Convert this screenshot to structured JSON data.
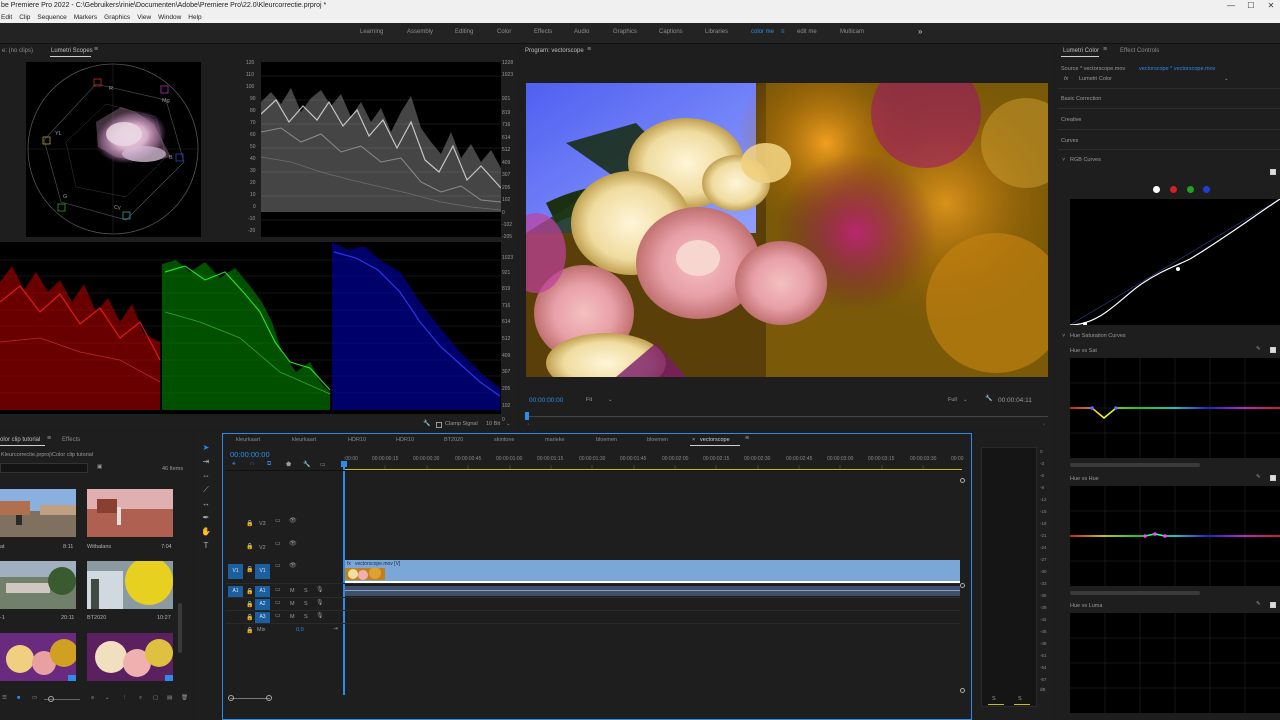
{
  "window": {
    "title": "be Premiere Pro 2022 - C:\\Gebruikers\\rinie\\Documenten\\Adobe\\Premiere Pro\\22.0\\Kleurcorrectie.prproj *",
    "minimize": "—",
    "maximize": "☐",
    "close": "✕"
  },
  "menu": [
    "Edit",
    "Clip",
    "Sequence",
    "Markers",
    "Graphics",
    "View",
    "Window",
    "Help"
  ],
  "workspaces": {
    "items": [
      "Learning",
      "Assembly",
      "Editing",
      "Color",
      "Effects",
      "Audio",
      "Graphics",
      "Captions",
      "Libraries",
      "color me",
      "edit me",
      "Multicam"
    ],
    "active": "color me",
    "more": "»"
  },
  "scopes": {
    "source_tab": "e: (no clips)",
    "tab": "Lumetri Scopes",
    "waveform_ticks_left": [
      "120",
      "110",
      "100",
      "90",
      "80",
      "70",
      "60",
      "50",
      "40",
      "30",
      "20",
      "10",
      "0",
      "-10",
      "-20"
    ],
    "waveform_ticks_right": [
      "1228",
      "1023",
      "921",
      "819",
      "716",
      "614",
      "512",
      "409",
      "307",
      "205",
      "102",
      "0",
      "-102",
      "-205"
    ],
    "parade_ticks_right": [
      "1023",
      "921",
      "819",
      "716",
      "614",
      "512",
      "409",
      "307",
      "205",
      "102",
      "0"
    ],
    "vectorscope_labels": [
      "R",
      "Mg",
      "YL",
      "B",
      "G",
      "Cy"
    ],
    "clamp_signal_label": "Clamp Signal",
    "bit_depth": "10 Bit"
  },
  "program": {
    "title": "Program: vectorscope",
    "timecode": "00:00:00:00",
    "fit": "Fit",
    "quality": "Full",
    "duration": "00:00:04:11"
  },
  "lumetri": {
    "tabs": [
      "Lumetri Color",
      "Effect Controls"
    ],
    "source": "Source * vectorscope.mov",
    "sequence": "vectorscope * vectorscope.mov",
    "fx_label": "fx",
    "effect_name": "Lumetri Color",
    "sections": [
      "Basic Correction",
      "Creative",
      "Curves"
    ],
    "rgb_curves": "RGB Curves",
    "hue_sat_curves": "Hue Saturation Curves",
    "hue_vs_sat": "Hue vs Sat",
    "hue_vs_hue": "Hue vs Hue",
    "hue_vs_luma": "Hue vs Luma",
    "channel_colors": [
      "#ffffff",
      "#d42020",
      "#1fa01f",
      "#1f3fd4"
    ]
  },
  "project": {
    "tabs": [
      "olor clip tutorial",
      "Effects"
    ],
    "path": "Kleurcorrectie.prproj\\Color clip tutorial",
    "item_count": "46 Items",
    "thumbnails": [
      {
        "name": "at",
        "duration": "8:11"
      },
      {
        "name": "Witbalans",
        "duration": "7:04"
      },
      {
        "name": "-1",
        "duration": "20:11"
      },
      {
        "name": "BT2020",
        "duration": "10:27"
      }
    ]
  },
  "timeline": {
    "sequence_tabs": [
      "kleurkaart",
      "kleurkaart",
      "HDR10",
      "HDR10",
      "BT2020",
      "skintone",
      "marieke",
      "bloemen",
      "bloemen",
      "vectorscope"
    ],
    "active_sequence": "vectorscope",
    "close_glyph": "×",
    "timecode": "00:00:00:00",
    "ruler": [
      ":00:00",
      "00:00:00:15",
      "00:00:00:30",
      "00:00:00:45",
      "00:00:01:00",
      "00:00:01:15",
      "00:00:01:30",
      "00:00:01:45",
      "00:00:02:00",
      "00:00:02:15",
      "00:00:02:30",
      "00:00:02:45",
      "00:00:03:00",
      "00:00:03:15",
      "00:00:03:30",
      "00:00"
    ],
    "video_tracks": [
      "V3",
      "V2",
      "V1"
    ],
    "audio_tracks": [
      "A1",
      "A2",
      "A3"
    ],
    "target_video": "V1",
    "target_audio": "A1",
    "mute": "M",
    "solo": "S",
    "mix_label": "Mix",
    "mix_value": "0,0",
    "clip_name": "vectorscope.mov [V]",
    "fx_badge": "fx"
  },
  "meter": {
    "ticks": [
      "0",
      "-3",
      "-6",
      "-9",
      "-12",
      "-15",
      "-18",
      "-21",
      "-24",
      "-27",
      "-30",
      "-33",
      "-36",
      "-39",
      "-42",
      "-45",
      "-48",
      "-51",
      "-54",
      "-57",
      "dB"
    ],
    "solo_left": "S",
    "solo_right": "S"
  }
}
